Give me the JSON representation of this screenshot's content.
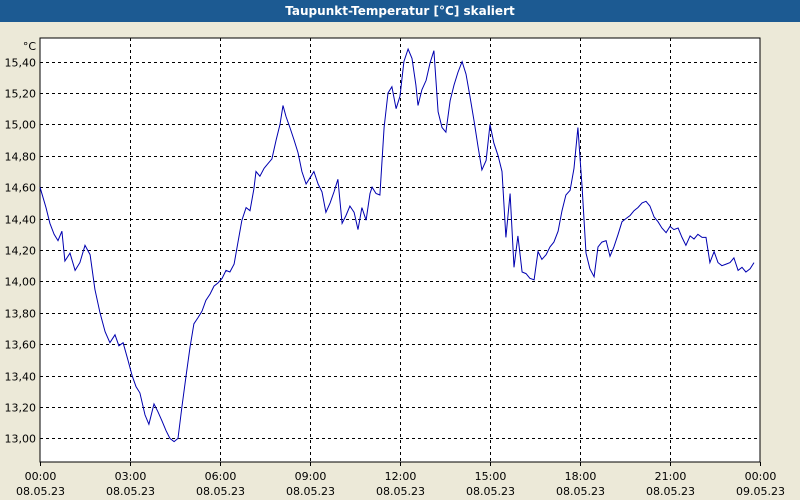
{
  "window": {
    "title": "Taupunkt-Temperatur [°C] skaliert"
  },
  "colors": {
    "title_bar": "#1c5a92",
    "line": "#0000b0",
    "grid": "#000000",
    "background": "#ece9d8",
    "plot_background": "#ffffff"
  },
  "chart_data": {
    "type": "line",
    "unit_label": "°C",
    "ylim": [
      12.85,
      15.55
    ],
    "y_ticks": [
      "13,00",
      "13,20",
      "13,40",
      "13,60",
      "13,80",
      "14,00",
      "14,20",
      "14,40",
      "14,60",
      "14,80",
      "15,00",
      "15,20",
      "15,40"
    ],
    "y_tick_values": [
      13.0,
      13.2,
      13.4,
      13.6,
      13.8,
      14.0,
      14.2,
      14.4,
      14.6,
      14.8,
      15.0,
      15.2,
      15.4
    ],
    "x_ticks": [
      {
        "time": "00:00",
        "date": "08.05.23",
        "hour": 0
      },
      {
        "time": "03:00",
        "date": "08.05.23",
        "hour": 3
      },
      {
        "time": "06:00",
        "date": "08.05.23",
        "hour": 6
      },
      {
        "time": "09:00",
        "date": "08.05.23",
        "hour": 9
      },
      {
        "time": "12:00",
        "date": "08.05.23",
        "hour": 12
      },
      {
        "time": "15:00",
        "date": "08.05.23",
        "hour": 15
      },
      {
        "time": "18:00",
        "date": "08.05.23",
        "hour": 18
      },
      {
        "time": "21:00",
        "date": "08.05.23",
        "hour": 21
      },
      {
        "time": "00:00",
        "date": "09.05.23",
        "hour": 24
      }
    ],
    "grid": true,
    "series": [
      {
        "values": [
          [
            0.0,
            14.6
          ],
          [
            0.2,
            14.47
          ],
          [
            0.33,
            14.37
          ],
          [
            0.47,
            14.3
          ],
          [
            0.6,
            14.26
          ],
          [
            0.73,
            14.32
          ],
          [
            0.83,
            14.13
          ],
          [
            1.0,
            14.18
          ],
          [
            1.17,
            14.07
          ],
          [
            1.33,
            14.12
          ],
          [
            1.5,
            14.23
          ],
          [
            1.67,
            14.17
          ],
          [
            1.83,
            13.95
          ],
          [
            2.0,
            13.8
          ],
          [
            2.17,
            13.68
          ],
          [
            2.33,
            13.61
          ],
          [
            2.5,
            13.66
          ],
          [
            2.63,
            13.59
          ],
          [
            2.77,
            13.61
          ],
          [
            2.93,
            13.5
          ],
          [
            3.07,
            13.4
          ],
          [
            3.2,
            13.33
          ],
          [
            3.33,
            13.29
          ],
          [
            3.5,
            13.15
          ],
          [
            3.63,
            13.09
          ],
          [
            3.8,
            13.22
          ],
          [
            3.93,
            13.17
          ],
          [
            4.07,
            13.11
          ],
          [
            4.2,
            13.05
          ],
          [
            4.33,
            13.0
          ],
          [
            4.47,
            12.98
          ],
          [
            4.6,
            13.0
          ],
          [
            4.73,
            13.2
          ],
          [
            4.87,
            13.4
          ],
          [
            5.0,
            13.58
          ],
          [
            5.13,
            13.73
          ],
          [
            5.27,
            13.77
          ],
          [
            5.4,
            13.81
          ],
          [
            5.53,
            13.88
          ],
          [
            5.67,
            13.92
          ],
          [
            5.8,
            13.97
          ],
          [
            5.93,
            13.99
          ],
          [
            6.07,
            14.02
          ],
          [
            6.2,
            14.07
          ],
          [
            6.33,
            14.06
          ],
          [
            6.47,
            14.11
          ],
          [
            6.6,
            14.25
          ],
          [
            6.73,
            14.39
          ],
          [
            6.87,
            14.47
          ],
          [
            7.0,
            14.45
          ],
          [
            7.13,
            14.59
          ],
          [
            7.2,
            14.7
          ],
          [
            7.33,
            14.67
          ],
          [
            7.47,
            14.72
          ],
          [
            7.6,
            14.75
          ],
          [
            7.73,
            14.78
          ],
          [
            7.87,
            14.9
          ],
          [
            8.0,
            15.0
          ],
          [
            8.1,
            15.12
          ],
          [
            8.2,
            15.05
          ],
          [
            8.33,
            14.98
          ],
          [
            8.47,
            14.9
          ],
          [
            8.6,
            14.82
          ],
          [
            8.73,
            14.7
          ],
          [
            8.87,
            14.62
          ],
          [
            9.0,
            14.66
          ],
          [
            9.13,
            14.7
          ],
          [
            9.27,
            14.62
          ],
          [
            9.4,
            14.57
          ],
          [
            9.53,
            14.44
          ],
          [
            9.67,
            14.5
          ],
          [
            9.8,
            14.57
          ],
          [
            9.93,
            14.65
          ],
          [
            10.07,
            14.37
          ],
          [
            10.2,
            14.42
          ],
          [
            10.33,
            14.48
          ],
          [
            10.47,
            14.44
          ],
          [
            10.6,
            14.33
          ],
          [
            10.73,
            14.47
          ],
          [
            10.87,
            14.39
          ],
          [
            11.0,
            14.56
          ],
          [
            11.07,
            14.6
          ],
          [
            11.2,
            14.56
          ],
          [
            11.33,
            14.55
          ],
          [
            11.47,
            14.98
          ],
          [
            11.6,
            15.2
          ],
          [
            11.73,
            15.24
          ],
          [
            11.87,
            15.1
          ],
          [
            12.0,
            15.18
          ],
          [
            12.13,
            15.4
          ],
          [
            12.27,
            15.48
          ],
          [
            12.4,
            15.42
          ],
          [
            12.53,
            15.25
          ],
          [
            12.6,
            15.12
          ],
          [
            12.73,
            15.22
          ],
          [
            12.87,
            15.28
          ],
          [
            13.0,
            15.39
          ],
          [
            13.13,
            15.47
          ],
          [
            13.27,
            15.08
          ],
          [
            13.4,
            14.98
          ],
          [
            13.53,
            14.95
          ],
          [
            13.67,
            15.15
          ],
          [
            13.8,
            15.25
          ],
          [
            13.93,
            15.33
          ],
          [
            14.07,
            15.4
          ],
          [
            14.2,
            15.32
          ],
          [
            14.33,
            15.18
          ],
          [
            14.47,
            15.02
          ],
          [
            14.6,
            14.86
          ],
          [
            14.73,
            14.71
          ],
          [
            14.87,
            14.77
          ],
          [
            15.0,
            15.0
          ],
          [
            15.13,
            14.88
          ],
          [
            15.27,
            14.8
          ],
          [
            15.4,
            14.7
          ],
          [
            15.53,
            14.28
          ],
          [
            15.67,
            14.56
          ],
          [
            15.8,
            14.09
          ],
          [
            15.93,
            14.29
          ],
          [
            16.07,
            14.06
          ],
          [
            16.2,
            14.05
          ],
          [
            16.33,
            14.02
          ],
          [
            16.47,
            14.01
          ],
          [
            16.6,
            14.19
          ],
          [
            16.73,
            14.14
          ],
          [
            16.87,
            14.17
          ],
          [
            17.0,
            14.22
          ],
          [
            17.13,
            14.25
          ],
          [
            17.27,
            14.32
          ],
          [
            17.4,
            14.45
          ],
          [
            17.53,
            14.55
          ],
          [
            17.67,
            14.58
          ],
          [
            17.8,
            14.72
          ],
          [
            17.93,
            14.98
          ],
          [
            18.07,
            14.6
          ],
          [
            18.2,
            14.18
          ],
          [
            18.33,
            14.08
          ],
          [
            18.47,
            14.03
          ],
          [
            18.6,
            14.22
          ],
          [
            18.73,
            14.25
          ],
          [
            18.87,
            14.26
          ],
          [
            19.0,
            14.16
          ],
          [
            19.13,
            14.22
          ],
          [
            19.27,
            14.3
          ],
          [
            19.4,
            14.38
          ],
          [
            19.53,
            14.4
          ],
          [
            19.67,
            14.42
          ],
          [
            19.8,
            14.45
          ],
          [
            19.93,
            14.47
          ],
          [
            20.07,
            14.5
          ],
          [
            20.2,
            14.51
          ],
          [
            20.33,
            14.48
          ],
          [
            20.47,
            14.41
          ],
          [
            20.6,
            14.38
          ],
          [
            20.73,
            14.34
          ],
          [
            20.87,
            14.31
          ],
          [
            21.0,
            14.35
          ],
          [
            21.13,
            14.33
          ],
          [
            21.27,
            14.34
          ],
          [
            21.4,
            14.28
          ],
          [
            21.53,
            14.23
          ],
          [
            21.67,
            14.29
          ],
          [
            21.8,
            14.27
          ],
          [
            21.93,
            14.3
          ],
          [
            22.07,
            14.28
          ],
          [
            22.2,
            14.28
          ],
          [
            22.33,
            14.12
          ],
          [
            22.47,
            14.19
          ],
          [
            22.6,
            14.12
          ],
          [
            22.73,
            14.1
          ],
          [
            22.87,
            14.11
          ],
          [
            23.0,
            14.12
          ],
          [
            23.13,
            14.15
          ],
          [
            23.27,
            14.07
          ],
          [
            23.4,
            14.09
          ],
          [
            23.53,
            14.06
          ],
          [
            23.67,
            14.08
          ],
          [
            23.8,
            14.12
          ]
        ]
      }
    ]
  }
}
